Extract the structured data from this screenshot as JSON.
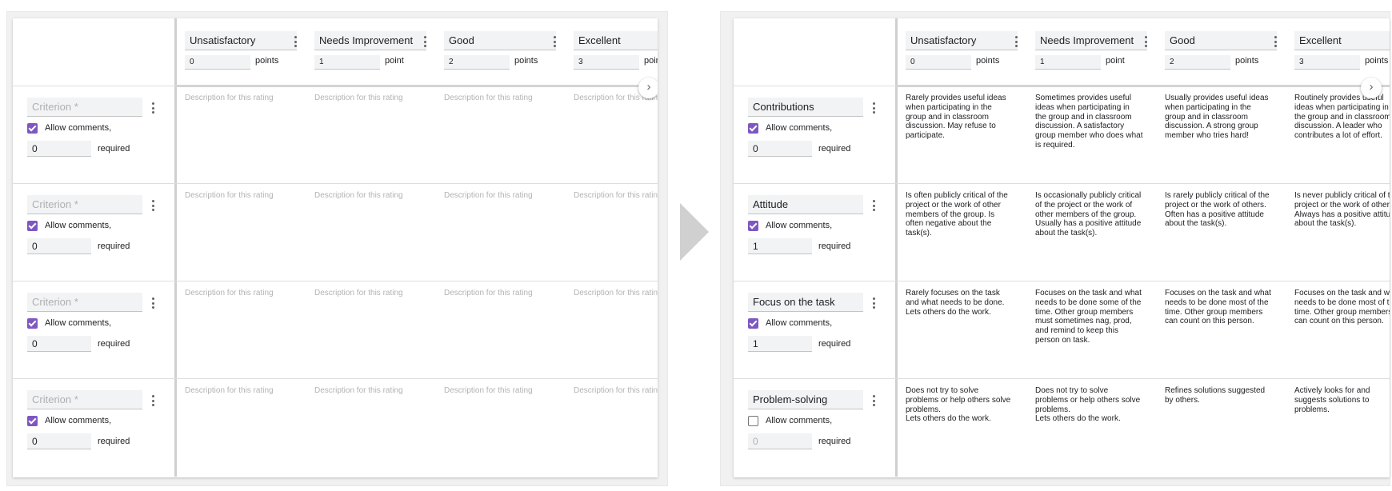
{
  "levels": [
    {
      "title": "Unsatisfactory",
      "points": "0",
      "unit": "points"
    },
    {
      "title": "Needs Improvement",
      "points": "1",
      "unit": "point"
    },
    {
      "title": "Good",
      "points": "2",
      "unit": "points"
    },
    {
      "title": "Excellent",
      "points": "3",
      "unit": "points"
    }
  ],
  "next_icon": "chevron-right-icon",
  "next_glyph": "›",
  "allow_comments_label": "Allow comments,",
  "required_label": "required",
  "before": {
    "rows": [
      {
        "criterion": "Criterion *",
        "comments_checked": true,
        "required": "0",
        "cells": [
          "Description for this rating",
          "Description for this rating",
          "Description for this rating",
          "Description for this rating"
        ]
      },
      {
        "criterion": "Criterion *",
        "comments_checked": true,
        "required": "0",
        "cells": [
          "Description for this rating",
          "Description for this rating",
          "Description for this rating",
          "Description for this rating"
        ]
      },
      {
        "criterion": "Criterion *",
        "comments_checked": true,
        "required": "0",
        "cells": [
          "Description for this rating",
          "Description for this rating",
          "Description for this rating",
          "Description for this rating"
        ]
      },
      {
        "criterion": "Criterion *",
        "comments_checked": true,
        "required": "0",
        "cells": [
          "Description for this rating",
          "Description for this rating",
          "Description for this rating",
          "Description for this rating"
        ]
      }
    ]
  },
  "after": {
    "rows": [
      {
        "criterion": "Contributions",
        "comments_checked": true,
        "required": "0",
        "cells": [
          "Rarely provides useful ideas\nwhen participating in the\ngroup and in classroom\ndiscussion. May refuse to\nparticipate.",
          "Sometimes provides useful\nideas when participating in\nthe group and in classroom\ndiscussion. A satisfactory\ngroup member who does what\nis required.",
          "Usually provides useful ideas\nwhen participating in the\ngroup and in classroom\ndiscussion. A strong group\nmember who tries hard!",
          "Routinely provides useful\nideas when participating in\nthe group and in classroom\ndiscussion. A leader who\ncontributes a lot of effort."
        ]
      },
      {
        "criterion": "Attitude",
        "comments_checked": true,
        "required": "1",
        "cells": [
          "Is often publicly critical of the\nproject or the work of other\nmembers of the group. Is\noften negative about the\ntask(s).",
          "Is occasionally publicly critical\nof the project or the work of\nother members of the group.\nUsually has a positive attitude\nabout the task(s).",
          "Is rarely publicly critical of the\nproject or the work of others.\nOften has a positive attitude\nabout the task(s).",
          "Is never publicly critical of the\nproject or the work of others.\nAlways has a positive attitude\nabout the task(s)."
        ]
      },
      {
        "criterion": "Focus on the task",
        "comments_checked": true,
        "required": "1",
        "cells": [
          "Rarely focuses on the task\nand what needs to be done.\nLets others do the work.",
          "Focuses on the task and what\nneeds to be done some of the\ntime. Other group members\nmust sometimes nag, prod,\nand remind to keep this\nperson on task.",
          "Focuses on the task and what\nneeds to be done most of the\ntime. Other group members\ncan count on this person.",
          "Focuses on the task and what\nneeds to be done most of the\ntime. Other group members\ncan count on this person."
        ]
      },
      {
        "criterion": "Problem-solving",
        "comments_checked": false,
        "required": "0",
        "cells": [
          "Does not try to solve\nproblems or help others solve\nproblems.\nLets others do the work.",
          "Does not try to solve\nproblems or help others solve\nproblems.\nLets others do the work.",
          "Refines solutions suggested\nby others.",
          "Actively looks for and\nsuggests solutions to\nproblems."
        ]
      }
    ]
  }
}
